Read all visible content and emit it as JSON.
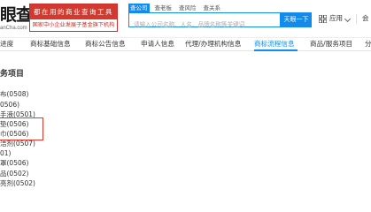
{
  "header": {
    "logo_text": "眼查",
    "logo_domain": "anCha.com",
    "banner_top": "都在用的商业查询工具",
    "banner_bottom": "国家中小企业发展子基金旗下机构",
    "search_tabs": [
      "查公司",
      "查老板",
      "查风险",
      "查关系"
    ],
    "search_placeholder": "请输入公司名称、人名、品牌名称等关键词",
    "search_button": "天眼一下",
    "menu_app": "应用",
    "menu_more": "会"
  },
  "nav": {
    "tabs": [
      "进度",
      "商标基础信息",
      "商标公告信息",
      "申请人信息",
      "代理/办理机构信息",
      "商标流程信息",
      "商品/服务项目",
      "分"
    ],
    "active_index": 5
  },
  "main": {
    "section_title": "务项目",
    "items": [
      "布(0508)",
      "0506)",
      "手液(0501)",
      "垫(0506)",
      "巾(0506)",
      "洁剂(0507)",
      "01)",
      "罩(0506)",
      "品(0502)",
      "亮剂(0502)"
    ]
  },
  "colors": {
    "accent": "#128bed",
    "banner_red": "#d23a2f",
    "highlight_red": "#e0392b"
  }
}
